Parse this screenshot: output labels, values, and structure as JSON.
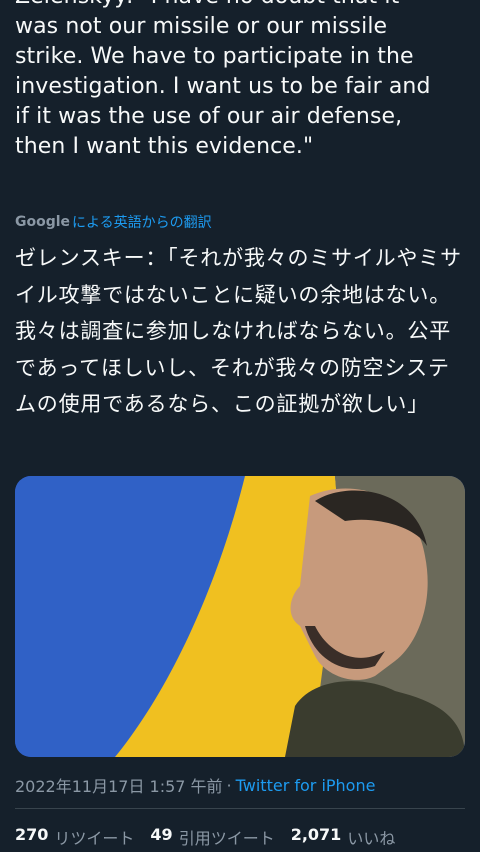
{
  "tweet": {
    "text": "Zelenskyy: \"I have no doubt that it\nwas not our missile or our missile\nstrike. We have to participate in the\ninvestigation. I want us to be fair and\nif it was the use of our air defense,\nthen I want this evidence.\"",
    "translation_provider": "Google",
    "translation_label": "による英語からの翻訳",
    "translated_text": "ゼレンスキー：「それが我々のミサイルやミサイル攻撃ではないことに疑いの余地はない。我々は調査に参加しなければならない。公平であってほしいし、それが我々の防空システムの使用であるなら、この証拠が欲しい」",
    "timestamp": "2022年11月17日 1:57 午前",
    "separator": "·",
    "source": "Twitter for iPhone"
  },
  "stats": [
    {
      "count": "270",
      "label": "リツイート"
    },
    {
      "count": "49",
      "label": "引用ツイート"
    },
    {
      "count": "2,071",
      "label": "いいね"
    }
  ],
  "colors": {
    "background": "#15202b",
    "text": "#f7f9f9",
    "secondary": "#8b98a5",
    "accent": "#1d9bf0",
    "flag_blue": "#2a56b8",
    "flag_yellow": "#f2c21a"
  }
}
